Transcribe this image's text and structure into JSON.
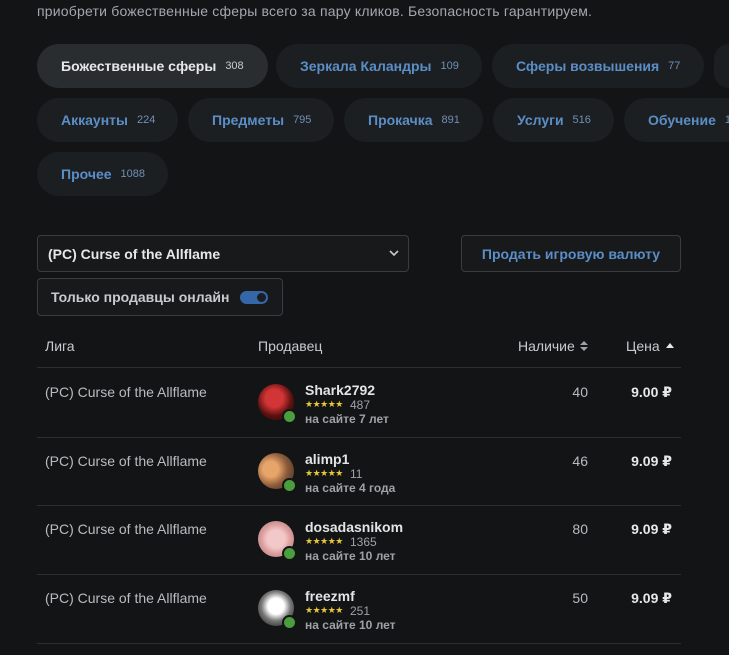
{
  "intro": {
    "line1": "",
    "line2": "приобрети божественные сферы всего за пару кликов. Безопасность гарантируем."
  },
  "categories": [
    {
      "label": "Божественные сферы",
      "count": "308",
      "active": true
    },
    {
      "label": "Зеркала Каландры",
      "count": "109"
    },
    {
      "label": "Сферы возвышения",
      "count": "77"
    },
    {
      "label": "Аккаунты",
      "count": "224"
    },
    {
      "label": "Предметы",
      "count": "795"
    },
    {
      "label": "Прокачка",
      "count": "891"
    },
    {
      "label": "Услуги",
      "count": "516"
    },
    {
      "label": "Обучение",
      "count": "1"
    },
    {
      "label": "Прочее",
      "count": "1088"
    }
  ],
  "filters": {
    "league_selected": "(PC) Curse of the Allflame",
    "sell_button": "Продать игровую валюту",
    "online_only_label": "Только продавцы онлайн",
    "online_only_enabled": true
  },
  "table": {
    "headers": {
      "league": "Лига",
      "seller": "Продавец",
      "stock": "Наличие",
      "price": "Цена"
    },
    "rows": [
      {
        "league": "(PC) Curse of the Allflame",
        "seller": "Shark2792",
        "reviews": "487",
        "since": "на сайте 7 лет",
        "stock": "40",
        "price": "9.00 ₽"
      },
      {
        "league": "(PC) Curse of the Allflame",
        "seller": "alimp1",
        "reviews": "11",
        "since": "на сайте 4 года",
        "stock": "46",
        "price": "9.09 ₽"
      },
      {
        "league": "(PC) Curse of the Allflame",
        "seller": "dosadasnikom",
        "reviews": "1365",
        "since": "на сайте 10 лет",
        "stock": "80",
        "price": "9.09 ₽"
      },
      {
        "league": "(PC) Curse of the Allflame",
        "seller": "freezmf",
        "reviews": "251",
        "since": "на сайте 10 лет",
        "stock": "50",
        "price": "9.09 ₽"
      }
    ],
    "stars": "★★★★★"
  },
  "colors": {
    "background": "#131416",
    "accent": "#5b8ec6",
    "online": "#4a9e3d",
    "stars": "#e8c53a"
  }
}
